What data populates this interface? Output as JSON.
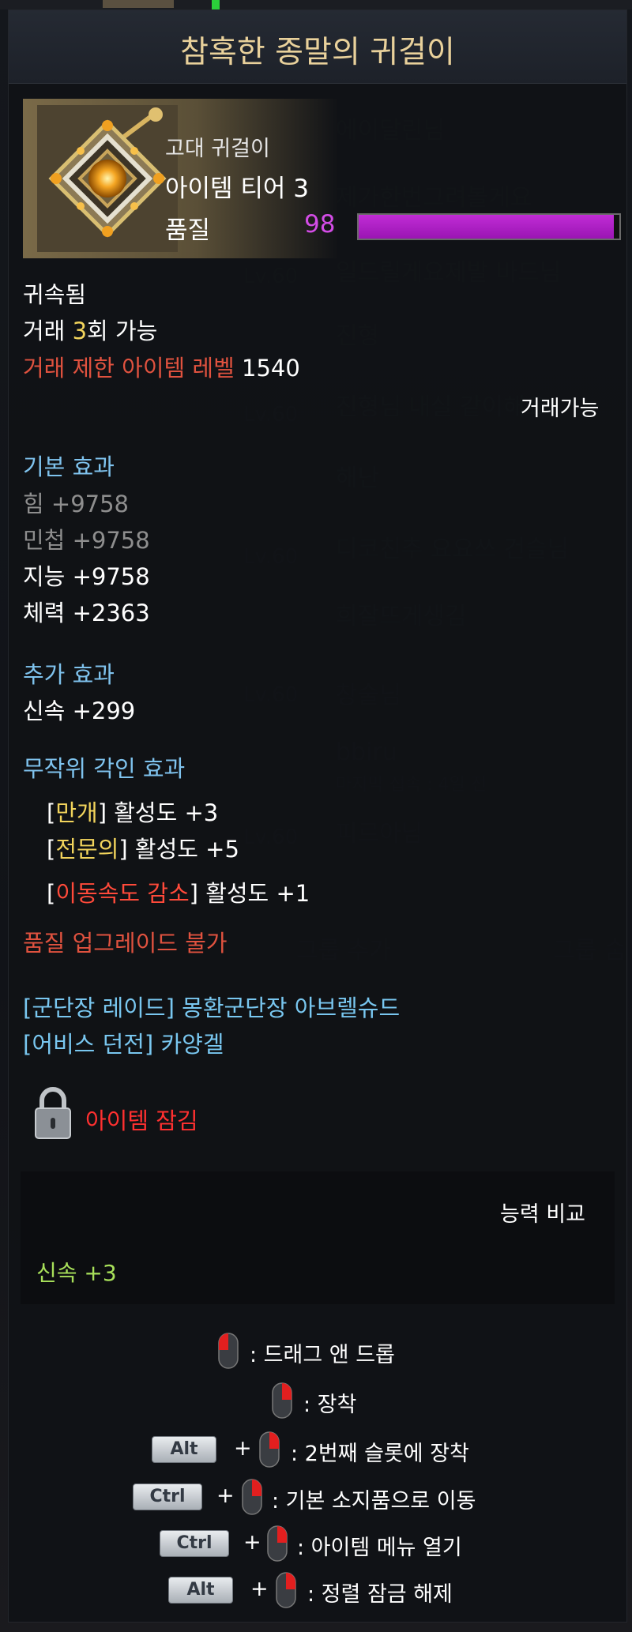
{
  "tooltip": {
    "title": "참혹한 종말의 귀걸이",
    "item_type": "고대 귀걸이",
    "tier": "아이템 티어 3",
    "quality_label": "품질",
    "quality_value": "98",
    "quality_fraction": 0.98,
    "bound": "귀속됨",
    "trade_prefix": "거래 ",
    "trade_count": "3",
    "trade_suffix": "회 가능",
    "trade_level_label": "거래 제한 아이템 레벨",
    "trade_level_value": " 1540",
    "tradeable": "거래가능",
    "basic_effect_header": "기본 효과",
    "basic_effects": [
      {
        "text": "힘 +9758",
        "active": false
      },
      {
        "text": "민첩 +9758",
        "active": false
      },
      {
        "text": "지능 +9758",
        "active": true
      },
      {
        "text": "체력 +2363",
        "active": true
      }
    ],
    "extra_effect_header": "추가 효과",
    "extra_effect": "신속 +299",
    "engrave_header": "무작위 각인 효과",
    "engravings": [
      {
        "name": "만개",
        "value": "활성도 +3",
        "color": "#f2d45c"
      },
      {
        "name": "전문의",
        "value": "활성도 +5",
        "color": "#f2d45c"
      },
      {
        "name": "이동속도 감소",
        "value": "활성도 +1",
        "color": "#ff4a3a"
      }
    ],
    "no_upgrade": "품질 업그레이드 불가",
    "sources": [
      "[군단장 레이드] 몽환군단장 아브렐슈드",
      "[어비스 던전] 카양겔"
    ],
    "lock_text": "아이템 잠김",
    "compare_title": "능력 비교",
    "compare_value": "신속 +3",
    "help": [
      {
        "keys": [],
        "text": ": 드래그 앤 드롭"
      },
      {
        "keys": [],
        "text": ": 장착"
      },
      {
        "keys": [
          "Alt"
        ],
        "text": ": 2번째 슬롯에 장착"
      },
      {
        "keys": [
          "Ctrl"
        ],
        "text": ": 기본 소지품으로 이동"
      },
      {
        "keys": [
          "Ctrl"
        ],
        "text": ": 아이템 메뉴 열기"
      },
      {
        "keys": [
          "Alt"
        ],
        "text": ": 정렬 잠금 해제"
      }
    ],
    "plus": "+"
  },
  "colors": {
    "title": "#e9d19b",
    "section": "#7fc3ee",
    "restriction": "#e0523f",
    "quality": "#c12cd6",
    "source": "#79c7f0",
    "lock": "#ff3030",
    "compare": "#a8e05a"
  },
  "icons": [
    "earring-icon",
    "lock-icon",
    "mouse-left-icon",
    "mouse-right-icon"
  ]
}
